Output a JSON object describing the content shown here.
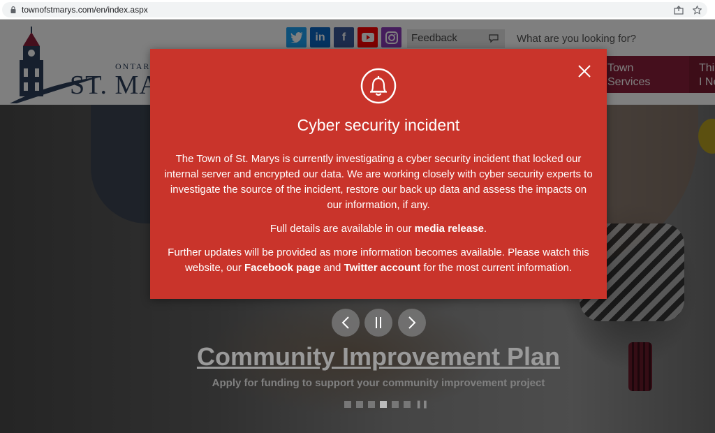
{
  "browser": {
    "url": "townofstmarys.com/en/index.aspx"
  },
  "header": {
    "logo_province": "ONTAR",
    "logo_name": "ST. MA",
    "social_icons": [
      "twitter-icon",
      "linkedin-icon",
      "facebook-icon",
      "youtube-icon",
      "instagram-icon"
    ],
    "feedback_label": "Feedback",
    "search_placeholder": "What are you looking for?",
    "nav": [
      {
        "line1": "Town",
        "line2": "Services"
      },
      {
        "line1": "Thi",
        "line2": "I Ne"
      }
    ]
  },
  "hero": {
    "title": "Community Improvement Plan",
    "subtitle": "Apply for funding to support your community improvement project",
    "slide_count": 6,
    "active_slide": 4
  },
  "modal": {
    "title": "Cyber security incident",
    "para1": "The Town of St. Marys is currently investigating a cyber security incident that locked our internal server and encrypted our data. We are working closely with cyber security experts to investigate the source of the incident, restore our back up data and assess the impacts on our information, if any.",
    "para2_pre": "Full details are available in our ",
    "para2_link": "media release",
    "para2_post": ".",
    "para3_pre": "Further updates will be provided as more information becomes available. Please watch this website, our ",
    "para3_link1": "Facebook page",
    "para3_mid": " and ",
    "para3_link2": "Twitter account",
    "para3_post": " for the most current information."
  },
  "colors": {
    "modal_bg": "#c9342b",
    "nav_accent": "#8b1f3a",
    "brand_navy": "#2c3e5a"
  }
}
